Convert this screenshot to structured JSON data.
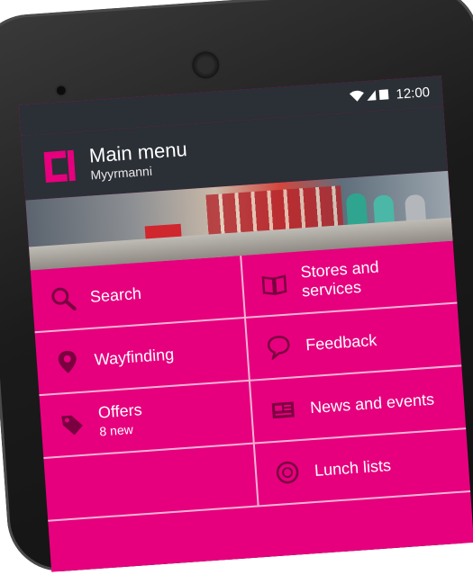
{
  "status_bar": {
    "time": "12:00",
    "icons": "wifi-signal-battery"
  },
  "app_bar": {
    "title": "Main menu",
    "subtitle": "Myyrmanni",
    "logo": "citycon-logo"
  },
  "menu": [
    {
      "label": "Search",
      "sub": "",
      "icon": "search-icon"
    },
    {
      "label": "Stores and services",
      "sub": "",
      "icon": "book-icon"
    },
    {
      "label": "Wayfinding",
      "sub": "",
      "icon": "location-pin-icon"
    },
    {
      "label": "Feedback",
      "sub": "",
      "icon": "speech-bubble-icon"
    },
    {
      "label": "Offers",
      "sub": "8 new",
      "icon": "tag-icon"
    },
    {
      "label": "News and events",
      "sub": "",
      "icon": "newspaper-icon"
    },
    {
      "label": "",
      "sub": "",
      "icon": ""
    },
    {
      "label": "Lunch lists",
      "sub": "",
      "icon": "plate-icon"
    }
  ],
  "colors": {
    "accent": "#e6007e",
    "appbar": "#2b2f36"
  }
}
